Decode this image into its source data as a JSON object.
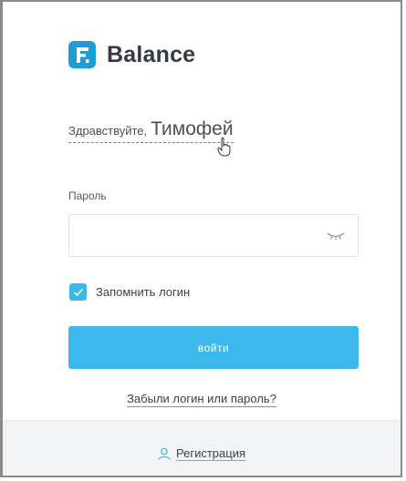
{
  "brand": {
    "logo_letter": "F",
    "name": "Balance",
    "logo_color": "#1e9cd7"
  },
  "greeting": {
    "hello": "Здравствуйте,",
    "user_name": "Тимофей"
  },
  "password": {
    "label": "Пароль",
    "value": "",
    "placeholder": "",
    "toggle_icon": "eye-closed-icon"
  },
  "remember": {
    "label": "Запомнить логин",
    "checked": true,
    "color": "#3ab6eb"
  },
  "login_button": {
    "label": "войти",
    "color": "#3cb8ec"
  },
  "forgot_link": "Забыли логин или пароль?",
  "register": {
    "label": "Регистрация",
    "icon": "user-icon"
  }
}
